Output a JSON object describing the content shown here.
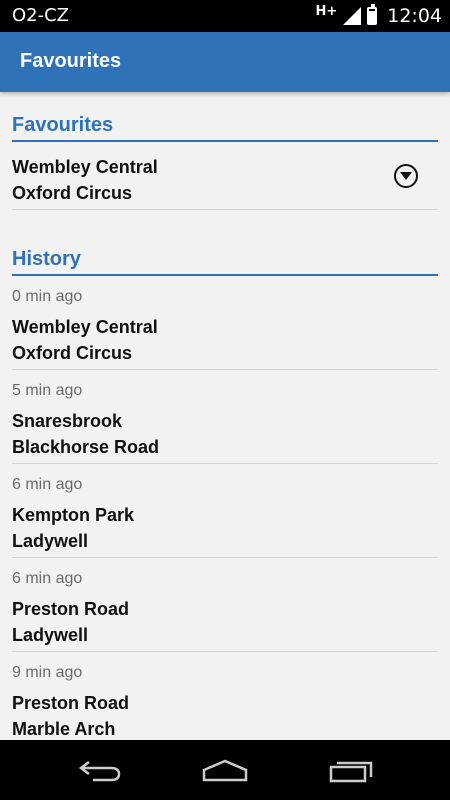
{
  "status_bar": {
    "carrier": "O2-CZ",
    "network_type": "H+",
    "time": "12:04",
    "battery_level": 0.85,
    "icons": [
      "signal-icon",
      "battery-icon"
    ]
  },
  "action_bar": {
    "title": "Favourites"
  },
  "favourites": {
    "header": "Favourites",
    "items": [
      {
        "from": "Wembley Central",
        "to": "Oxford Circus",
        "menu_icon": "dropdown-circle-icon"
      }
    ]
  },
  "history": {
    "header": "History",
    "items": [
      {
        "time_ago": "0 min ago",
        "from": "Wembley Central",
        "to": "Oxford Circus"
      },
      {
        "time_ago": "5 min ago",
        "from": "Snaresbrook",
        "to": "Blackhorse Road"
      },
      {
        "time_ago": "6 min ago",
        "from": "Kempton Park",
        "to": "Ladywell"
      },
      {
        "time_ago": "6 min ago",
        "from": "Preston Road",
        "to": "Ladywell"
      },
      {
        "time_ago": "9 min ago",
        "from": "Preston Road",
        "to": "Marble Arch"
      }
    ]
  },
  "nav_bar": {
    "buttons": [
      "back-icon",
      "home-icon",
      "recent-apps-icon"
    ]
  },
  "colors": {
    "accent": "#2f72b8",
    "background": "#f2f2f2",
    "divider": "#d6d6d6"
  }
}
